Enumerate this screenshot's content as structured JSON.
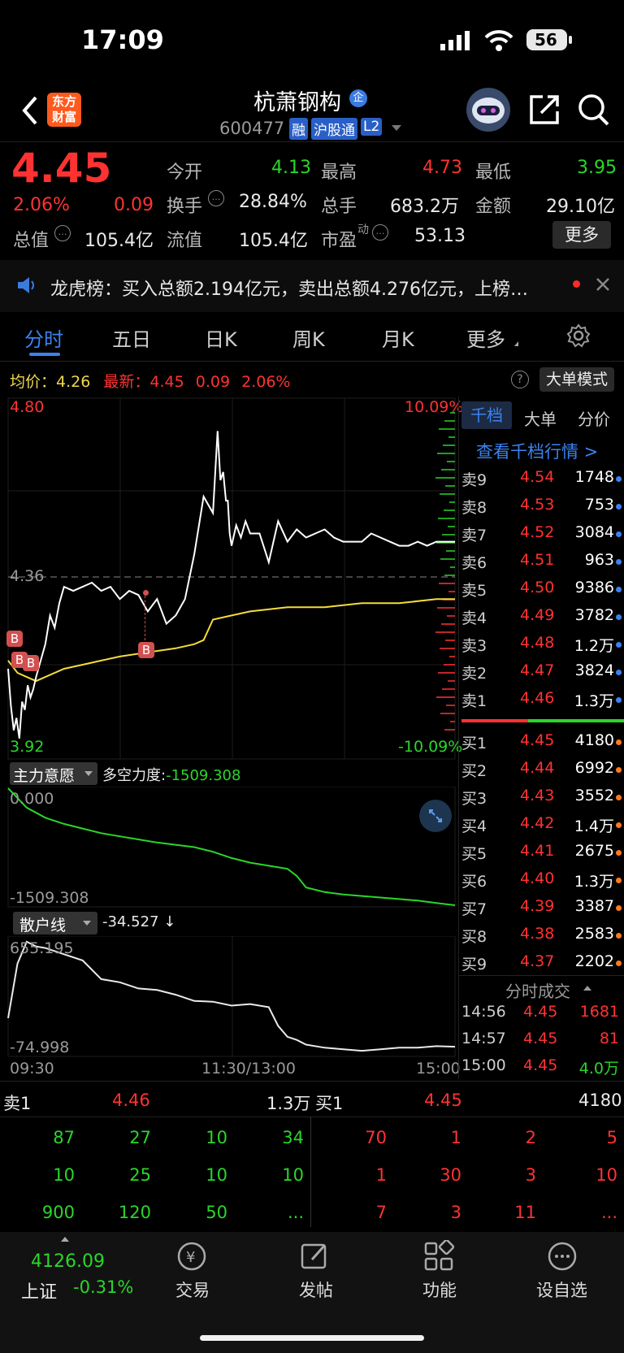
{
  "status_bar": {
    "time": "17:09",
    "battery": "56"
  },
  "header": {
    "stock_name": "杭萧钢构",
    "badge_qi": "企",
    "code": "600477",
    "tags": [
      "融",
      "沪股通",
      "L2"
    ],
    "logo_line1": "东方",
    "logo_line2": "财富"
  },
  "quote": {
    "price": "4.45",
    "change_pct": "2.06%",
    "change": "0.09",
    "total_value_label": "总值",
    "total_value": "105.4亿",
    "open_label": "今开",
    "open": "4.13",
    "high_label": "最高",
    "high": "4.73",
    "low_label": "最低",
    "low": "3.95",
    "turnover_label": "换手",
    "turnover": "28.84%",
    "volume_label": "总手",
    "volume": "683.2万",
    "amount_label": "金额",
    "amount": "29.10亿",
    "float_label": "流值",
    "float_value": "105.4亿",
    "pe_label": "市盈",
    "pe_sup": "动",
    "pe": "53.13",
    "more_button": "更多"
  },
  "notice": {
    "text": "龙虎榜：买入总额2.194亿元，卖出总额4.276亿元，上榜…"
  },
  "tabs": [
    "分时",
    "五日",
    "日K",
    "周K",
    "月K",
    "更多"
  ],
  "info_line": {
    "avg_label": "均价：",
    "avg": "4.26",
    "latest_label": "最新：",
    "latest": "4.45",
    "latest_chg": "0.09",
    "latest_pct": "2.06%",
    "mode_button": "大单模式"
  },
  "chart_data": [
    {
      "type": "line",
      "title": "分时",
      "y_labels": {
        "top": "4.80",
        "mid": "4.36",
        "bottom": "3.92",
        "top_pct": "10.09%",
        "bottom_pct": "-10.09%"
      },
      "ylim": [
        3.92,
        4.8
      ],
      "x_labels": [
        "09:30",
        "11:30/13:00",
        "15:00"
      ],
      "series": [
        {
          "name": "price",
          "color": "#ffffff",
          "x": [
            0,
            3,
            6,
            9,
            12,
            15,
            18,
            21,
            24,
            27,
            30,
            35,
            40,
            45,
            50,
            55,
            60,
            70,
            80,
            90,
            100,
            110,
            120,
            130,
            140,
            150,
            160,
            170,
            180,
            190,
            200,
            210,
            220,
            225,
            228,
            231,
            234,
            236,
            238,
            240,
            245,
            250,
            255,
            260,
            270,
            280,
            290,
            300,
            310,
            320,
            330,
            340,
            350,
            360,
            370,
            380,
            390,
            400,
            410,
            420,
            430,
            440,
            450,
            460,
            470,
            480
          ],
          "values": [
            4.14,
            4.05,
            3.99,
            4.02,
            3.97,
            4.06,
            4.04,
            4.1,
            4.07,
            4.09,
            4.12,
            4.16,
            4.2,
            4.27,
            4.24,
            4.3,
            4.34,
            4.33,
            4.34,
            4.35,
            4.33,
            4.34,
            4.31,
            4.33,
            4.32,
            4.28,
            4.31,
            4.25,
            4.27,
            4.31,
            4.42,
            4.56,
            4.52,
            4.72,
            4.6,
            4.62,
            4.55,
            4.55,
            4.47,
            4.44,
            4.49,
            4.46,
            4.5,
            4.47,
            4.47,
            4.4,
            4.5,
            4.45,
            4.48,
            4.46,
            4.47,
            4.48,
            4.46,
            4.45,
            4.45,
            4.45,
            4.47,
            4.46,
            4.45,
            4.44,
            4.44,
            4.45,
            4.44,
            4.45,
            4.45,
            4.45
          ]
        },
        {
          "name": "avg",
          "color": "#f5dc3c",
          "x": [
            0,
            10,
            20,
            30,
            40,
            60,
            80,
            100,
            120,
            150,
            180,
            200,
            210,
            220,
            240,
            260,
            300,
            340,
            380,
            420,
            460,
            480
          ],
          "values": [
            4.16,
            4.13,
            4.12,
            4.11,
            4.12,
            4.14,
            4.15,
            4.16,
            4.17,
            4.18,
            4.19,
            4.2,
            4.21,
            4.26,
            4.27,
            4.28,
            4.29,
            4.29,
            4.3,
            4.3,
            4.31,
            4.31
          ]
        }
      ]
    },
    {
      "type": "line",
      "title": "主力意愿",
      "y_labels": {
        "top": "0.000",
        "bottom": "-1509.308"
      },
      "ylim": [
        -1509.308,
        0
      ],
      "series": [
        {
          "name": "多空力度",
          "color": "#2ad62a",
          "x": [
            0,
            20,
            40,
            60,
            80,
            100,
            120,
            140,
            160,
            180,
            200,
            220,
            240,
            260,
            280,
            300,
            310,
            320,
            340,
            360,
            380,
            400,
            420,
            440,
            460,
            480
          ],
          "values": [
            0,
            -250,
            -380,
            -460,
            -520,
            -580,
            -620,
            -660,
            -700,
            -730,
            -760,
            -820,
            -900,
            -960,
            -1000,
            -1040,
            -1130,
            -1280,
            -1340,
            -1370,
            -1390,
            -1410,
            -1430,
            -1450,
            -1480,
            -1509.308
          ]
        }
      ],
      "current": "-1509.308"
    },
    {
      "type": "line",
      "title": "散户线",
      "y_labels": {
        "top": "655.195",
        "bottom": "-74.998"
      },
      "ylim": [
        -74.998,
        655.195
      ],
      "series": [
        {
          "name": "散户线",
          "color": "#eaeaea",
          "x": [
            0,
            10,
            20,
            30,
            40,
            60,
            80,
            100,
            120,
            140,
            160,
            180,
            200,
            220,
            240,
            260,
            280,
            290,
            300,
            310,
            320,
            340,
            360,
            380,
            400,
            420,
            440,
            460,
            480
          ],
          "values": [
            150,
            500,
            640,
            610,
            600,
            560,
            520,
            400,
            380,
            340,
            330,
            300,
            260,
            255,
            230,
            240,
            220,
            100,
            30,
            10,
            -20,
            -40,
            -50,
            -60,
            -50,
            -40,
            -40,
            -30,
            -34
          ]
        }
      ],
      "current": "-34.527"
    }
  ],
  "indicator1": {
    "name": "主力意愿",
    "label": "多空力度:",
    "value": "-1509.308"
  },
  "indicator2": {
    "name": "散户线",
    "value": "-34.527 ↓"
  },
  "orderbook": {
    "tabs": [
      "千档",
      "大单",
      "分价"
    ],
    "link": "查看千档行情 >",
    "asks": [
      {
        "label": "卖9",
        "price": "4.54",
        "vol": "1748"
      },
      {
        "label": "卖8",
        "price": "4.53",
        "vol": "753"
      },
      {
        "label": "卖7",
        "price": "4.52",
        "vol": "3084"
      },
      {
        "label": "卖6",
        "price": "4.51",
        "vol": "963"
      },
      {
        "label": "卖5",
        "price": "4.50",
        "vol": "9386"
      },
      {
        "label": "卖4",
        "price": "4.49",
        "vol": "3782"
      },
      {
        "label": "卖3",
        "price": "4.48",
        "vol": "1.2万"
      },
      {
        "label": "卖2",
        "price": "4.47",
        "vol": "3824"
      },
      {
        "label": "卖1",
        "price": "4.46",
        "vol": "1.3万"
      }
    ],
    "bids": [
      {
        "label": "买1",
        "price": "4.45",
        "vol": "4180"
      },
      {
        "label": "买2",
        "price": "4.44",
        "vol": "6992"
      },
      {
        "label": "买3",
        "price": "4.43",
        "vol": "3552"
      },
      {
        "label": "买4",
        "price": "4.42",
        "vol": "1.4万"
      },
      {
        "label": "买5",
        "price": "4.41",
        "vol": "2675"
      },
      {
        "label": "买6",
        "price": "4.40",
        "vol": "1.3万"
      },
      {
        "label": "买7",
        "price": "4.39",
        "vol": "3387"
      },
      {
        "label": "买8",
        "price": "4.38",
        "vol": "2583"
      },
      {
        "label": "买9",
        "price": "4.37",
        "vol": "2202"
      }
    ],
    "trades_title": "分时成交",
    "trades": [
      {
        "time": "14:56",
        "price": "4.45",
        "vol": "1681"
      },
      {
        "time": "14:57",
        "price": "4.45",
        "vol": "81"
      },
      {
        "time": "15:00",
        "price": "4.45",
        "vol": "4.0万"
      }
    ]
  },
  "queue": {
    "ask_label": "卖1",
    "ask_price": "4.46",
    "ask_vol": "1.3万",
    "bid_label": "买1",
    "bid_price": "4.45",
    "bid_vol": "4180",
    "ask_rows": [
      [
        "87",
        "27",
        "10",
        "34"
      ],
      [
        "10",
        "25",
        "10",
        "10"
      ],
      [
        "900",
        "120",
        "50",
        "..."
      ]
    ],
    "bid_rows": [
      [
        "70",
        "1",
        "2",
        "5"
      ],
      [
        "1",
        "30",
        "3",
        "10"
      ],
      [
        "7",
        "3",
        "11",
        "..."
      ]
    ]
  },
  "bottom_nav": {
    "index_value": "4126.09",
    "index_name": "上证",
    "index_change": "-0.31%",
    "items": [
      "交易",
      "发帖",
      "功能",
      "设自选"
    ]
  }
}
